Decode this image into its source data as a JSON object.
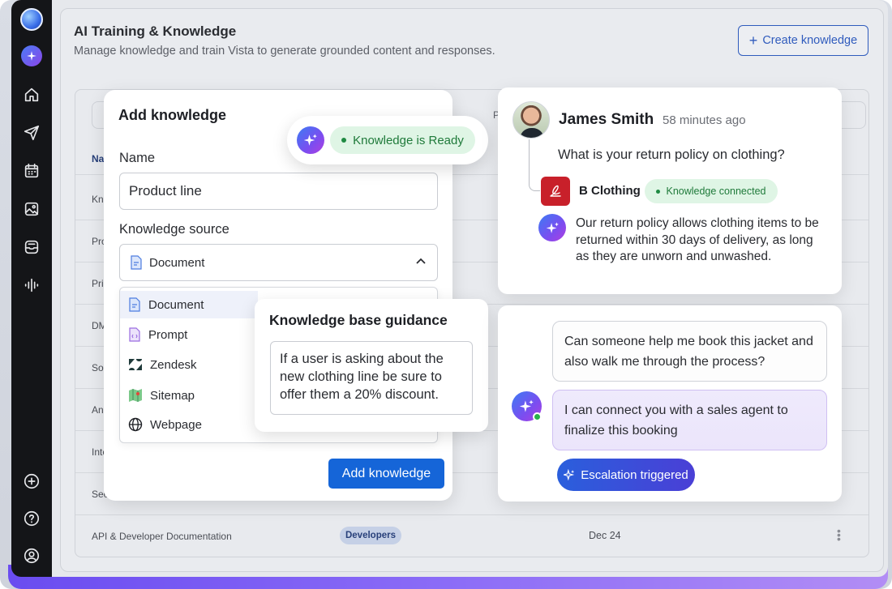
{
  "page": {
    "title": "AI Training & Knowledge",
    "subtitle": "Manage knowledge and train Vista to generate grounded content and responses.",
    "create_button": "Create knowledge"
  },
  "sidebar": {
    "icons": [
      "logo-icon",
      "ai-sparkle-icon",
      "home-icon",
      "send-icon",
      "calendar-icon",
      "image-icon",
      "inbox-icon",
      "audio-wave-icon"
    ],
    "bottom_icons": [
      "add-circle-icon",
      "help-icon",
      "user-icon"
    ]
  },
  "table": {
    "header_partial": "Na",
    "header_partial2": "P",
    "rows_partial": [
      "Kno",
      "Pro",
      "Pri",
      "DM",
      "Soc",
      "An",
      "Inte",
      "Sec"
    ],
    "last_row": {
      "name": "API & Developer Documentation",
      "tag": "Developers",
      "date": "Dec 24"
    }
  },
  "add_knowledge": {
    "title": "Add knowledge",
    "name_label": "Name",
    "name_value": "Product line",
    "source_label": "Knowledge source",
    "source_selected": "Document",
    "source_options": [
      "Document",
      "Prompt",
      "Zendesk",
      "Sitemap",
      "Webpage"
    ],
    "submit": "Add knowledge"
  },
  "ready_status": {
    "label": "Knowledge is Ready"
  },
  "guidance": {
    "title": "Knowledge base guidance",
    "text": "If a user is asking about the new clothing line be sure to offer them a 20% discount."
  },
  "chat1": {
    "user_name": "James Smith",
    "time": "58 minutes ago",
    "question": "What is your return policy on clothing?",
    "brand": "B Clothing",
    "brand_status": "Knowledge connected",
    "answer": "Our return policy allows clothing items to be returned within 30 days of delivery, as long as they are unworn and unwashed."
  },
  "chat2": {
    "user_message": "Can someone help me book this jacket and also walk me through the process?",
    "ai_message": "I can connect you with a sales agent to finalize this booking",
    "escalation": "Escalation triggered"
  },
  "colors": {
    "primary": "#1565d8",
    "success_bg": "#dff5e5",
    "success_text": "#1f7a3a",
    "sidebar_bg": "#141518",
    "brand_red": "#c8202a"
  }
}
